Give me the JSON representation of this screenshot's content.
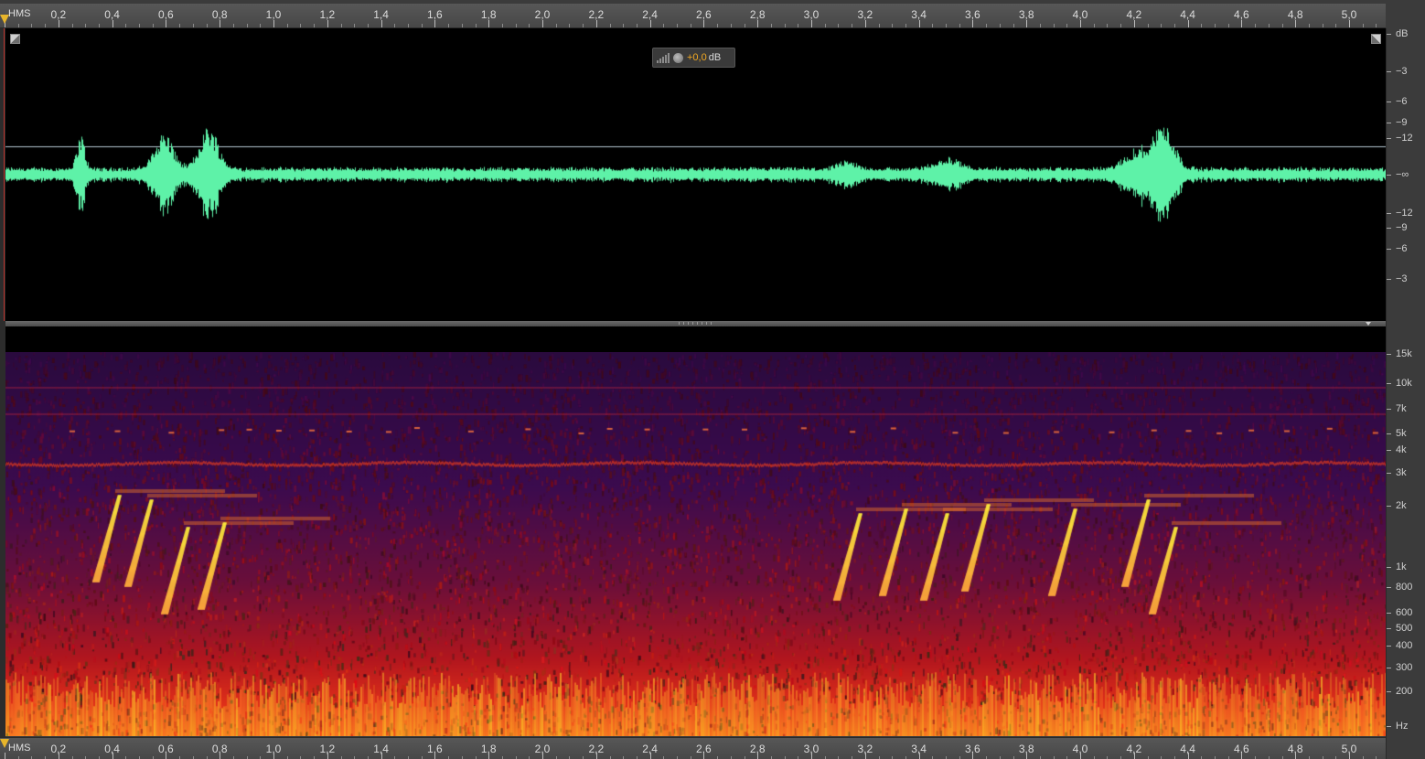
{
  "timeline": {
    "unit_label": "HMS",
    "tick_labels": [
      "0,2",
      "0,4",
      "0,6",
      "0,8",
      "1,0",
      "1,2",
      "1,4",
      "1,6",
      "1,8",
      "2,0",
      "2,2",
      "2,4",
      "2,6",
      "2,8",
      "3,0",
      "3,2",
      "3,4",
      "3,6",
      "3,8",
      "4,0",
      "4,2",
      "4,4",
      "4,6",
      "4,8",
      "5,0"
    ],
    "range_seconds": [
      0,
      5.15
    ]
  },
  "waveform": {
    "color": "#5ef2a8",
    "hud": {
      "value": "+0,0",
      "unit": "dB"
    },
    "db_scale": [
      "dB",
      "−3",
      "−6",
      "−9",
      "−12",
      "−∞",
      "−12",
      "−9",
      "−6",
      "−3"
    ]
  },
  "spectrogram": {
    "freq_scale": [
      "15k",
      "10k",
      "7k",
      "5k",
      "4k",
      "3k",
      "2k",
      "1k",
      "800",
      "600",
      "500",
      "400",
      "300",
      "200",
      "Hz"
    ]
  },
  "colors": {
    "background": "#3b3b3b",
    "ruler": "#4f4f4f",
    "hud_value": "#f2a922",
    "playhead": "#e7b52b"
  }
}
